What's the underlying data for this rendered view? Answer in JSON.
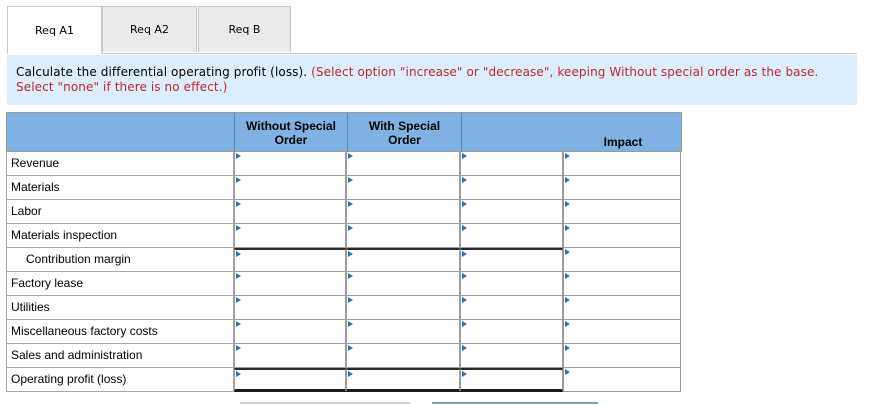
{
  "tabs": [
    {
      "label": "Req A1",
      "active": true
    },
    {
      "label": "Req A2",
      "active": false
    },
    {
      "label": "Req B",
      "active": false
    }
  ],
  "instruction": {
    "main": "Calculate the differential operating profit (loss). ",
    "note": "(Select option \"increase\" or \"decrease\", keeping Without special order as the base. Select \"none\" if there is no effect.)"
  },
  "table": {
    "headers": {
      "col1_line1": "Without Special",
      "col1_line2": "Order",
      "col2_line1": "With Special",
      "col2_line2": "Order",
      "col4": "Impact"
    },
    "rows": [
      {
        "label": "Revenue"
      },
      {
        "label": "Materials"
      },
      {
        "label": "Labor"
      },
      {
        "label": "Materials inspection"
      },
      {
        "label": "Contribution margin"
      },
      {
        "label": "Factory lease"
      },
      {
        "label": "Utilities"
      },
      {
        "label": "Miscellaneous factory costs"
      },
      {
        "label": "Sales and administration"
      },
      {
        "label": "Operating profit (loss)"
      }
    ]
  },
  "colors": {
    "header_bg": "#7fb1e4",
    "instruction_bg": "#dceefb",
    "note_red": "#c0282d",
    "dropdown_arrow": "#2f6fbd"
  }
}
